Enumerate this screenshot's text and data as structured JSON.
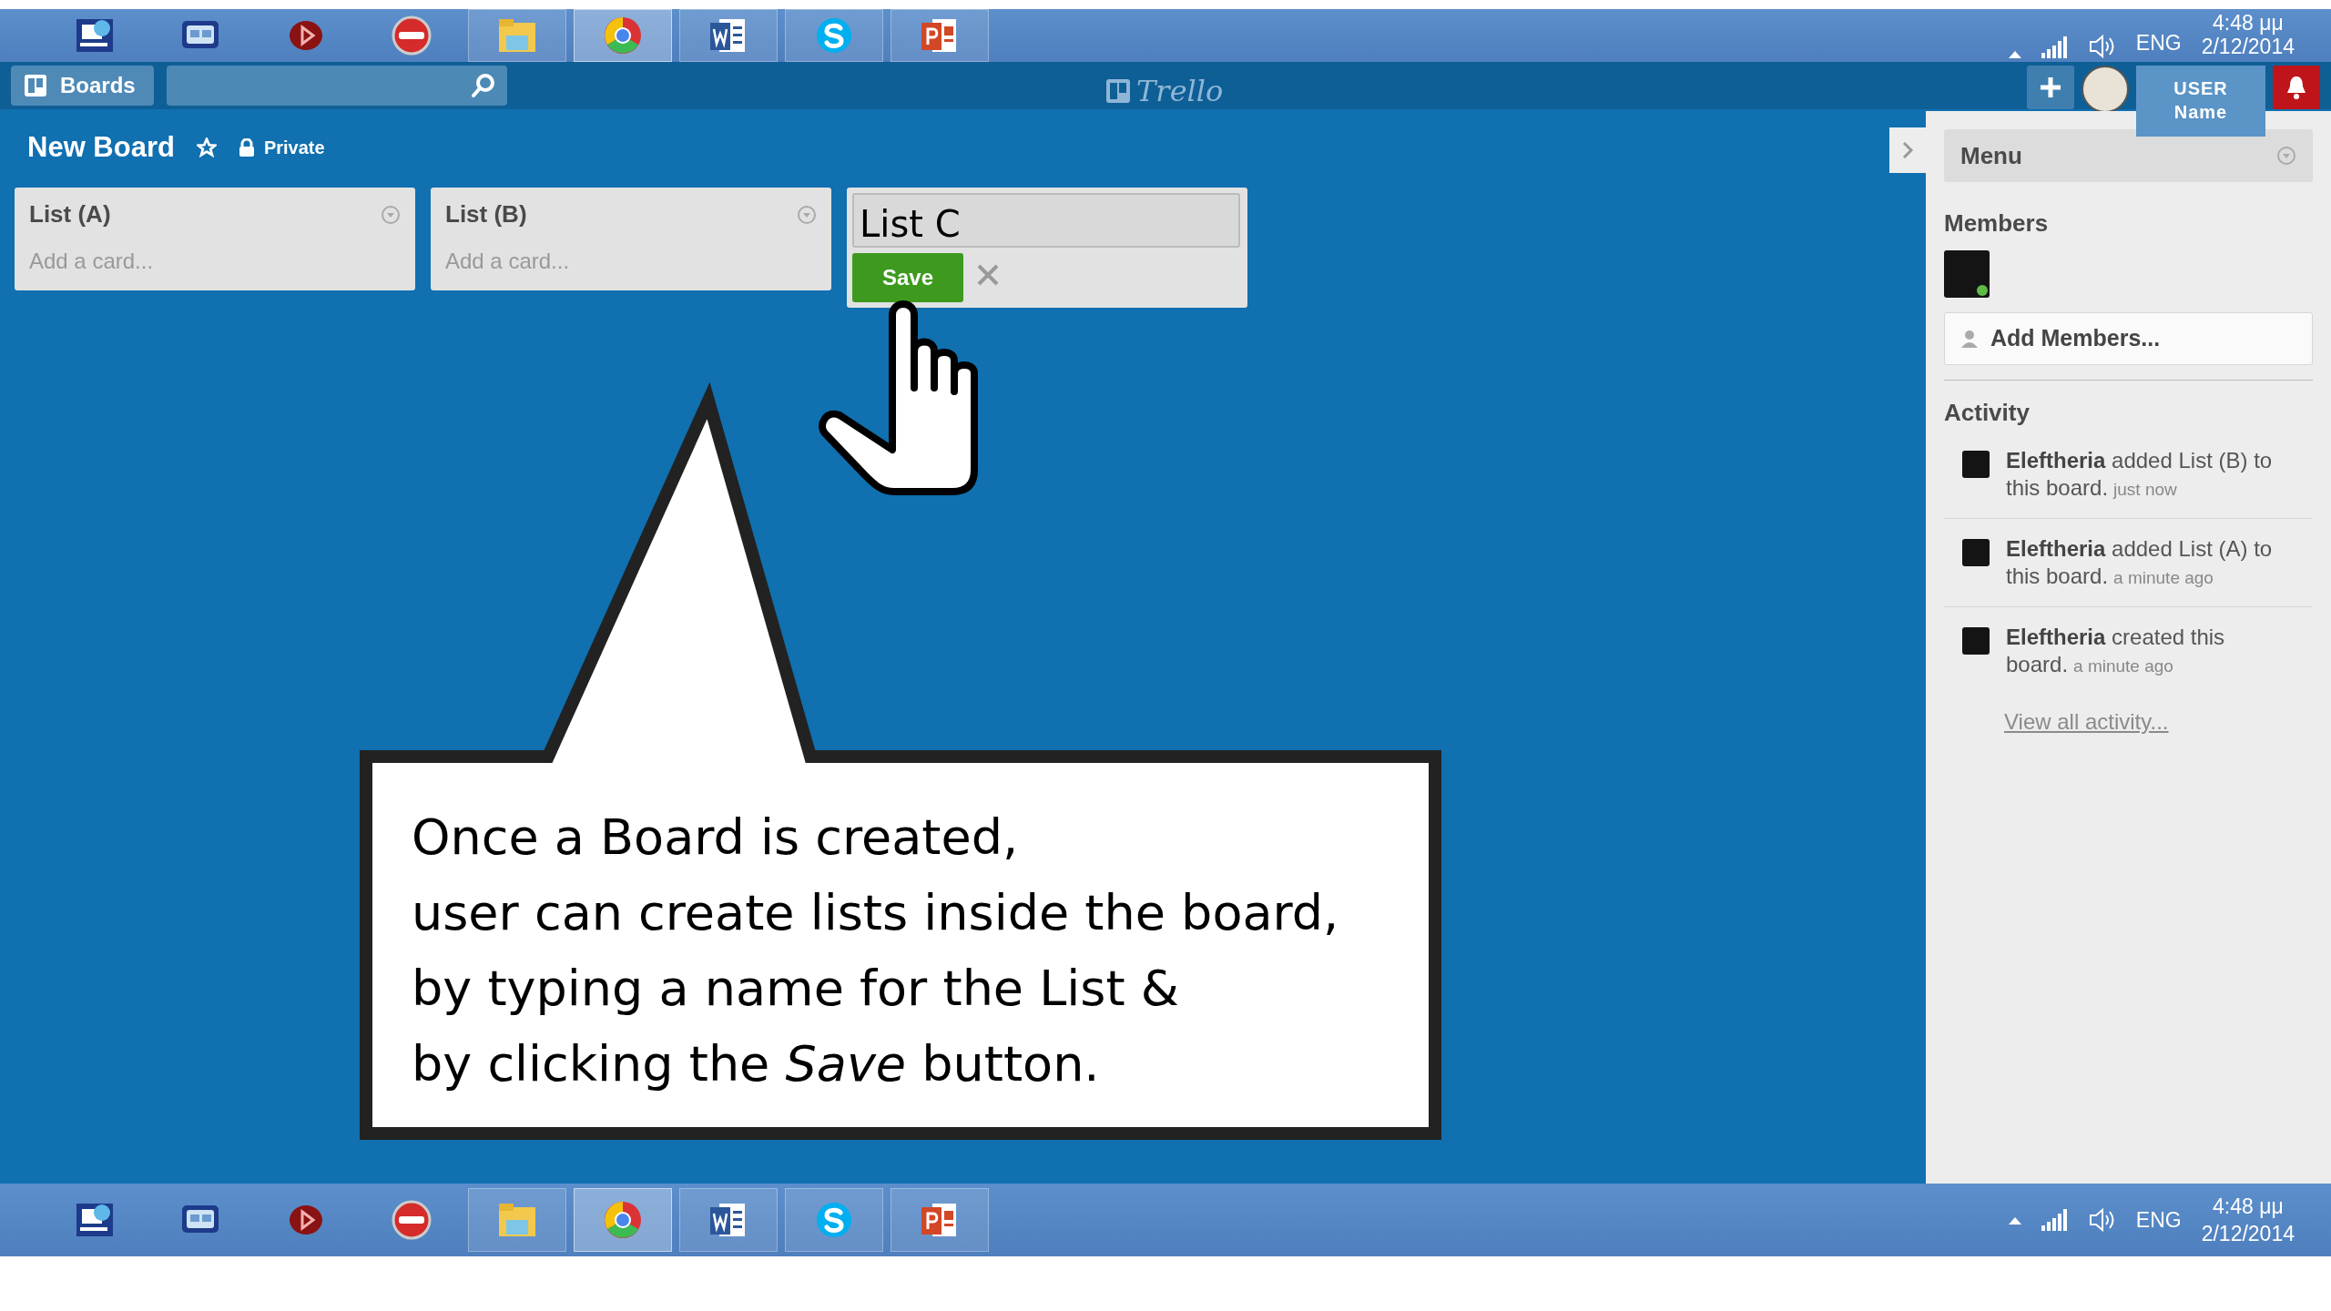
{
  "taskbar_top": {
    "apps": [
      {
        "kind": "connect",
        "selected": false
      },
      {
        "kind": "chat",
        "selected": false
      },
      {
        "kind": "player",
        "selected": false
      },
      {
        "kind": "nero",
        "selected": false
      },
      {
        "kind": "files",
        "selected": false
      },
      {
        "kind": "chrome",
        "selected": true
      },
      {
        "kind": "word",
        "selected": false
      },
      {
        "kind": "skype",
        "selected": false
      },
      {
        "kind": "powerpoint",
        "selected": false
      }
    ],
    "language": "ENG",
    "time": "4:48 μμ",
    "date": "2/12/2014"
  },
  "header": {
    "boards_button": "Boards",
    "logo": "Trello",
    "user_label": [
      "USER",
      "Name"
    ]
  },
  "board": {
    "title": "New Board",
    "visibility": "Private"
  },
  "lists": [
    {
      "title": "List (A)",
      "add_card": "Add a card..."
    },
    {
      "title": "List (B)",
      "add_card": "Add a card..."
    }
  ],
  "add_list": {
    "value": "List C",
    "save": "Save"
  },
  "sidebar": {
    "menu_title": "Menu",
    "members_heading": "Members",
    "members": [
      {
        "online": true
      }
    ],
    "add_members": "Add Members...",
    "activity_heading": "Activity",
    "activity": [
      {
        "name": "Eleftheria",
        "text": "added List (B) to this board.",
        "time": "just now"
      },
      {
        "name": "Eleftheria",
        "text": "added List (A) to this board.",
        "time": "a minute ago"
      },
      {
        "name": "Eleftheria",
        "text": "created this board.",
        "time": "a minute ago"
      }
    ],
    "view_all": "View all activity..."
  },
  "callout": {
    "lines": [
      "Once a Board is created,",
      "user can create lists inside the board,",
      "by typing a name for the List &",
      "by clicking the *Save* button."
    ]
  },
  "taskbar_bottom": {
    "apps": [
      {
        "kind": "connect",
        "selected": false
      },
      {
        "kind": "chat",
        "selected": false
      },
      {
        "kind": "player",
        "selected": false
      },
      {
        "kind": "nero",
        "selected": false
      },
      {
        "kind": "files",
        "selected": false
      },
      {
        "kind": "chrome",
        "selected": true
      },
      {
        "kind": "word",
        "selected": false
      },
      {
        "kind": "skype",
        "selected": false
      },
      {
        "kind": "powerpoint",
        "selected": false
      }
    ],
    "language": "ENG",
    "time": "4:48 μμ",
    "date": "2/12/2014"
  }
}
